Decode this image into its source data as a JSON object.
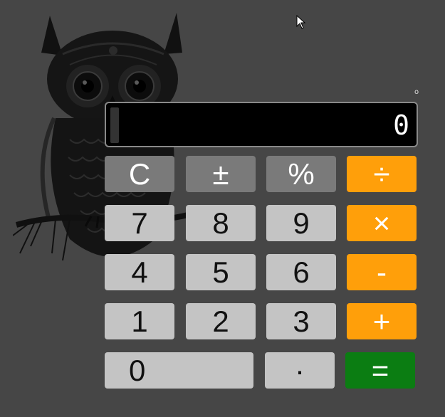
{
  "display": {
    "value": "0"
  },
  "decor": {
    "corner_mark": "o"
  },
  "keys": {
    "clear": "C",
    "sign": "±",
    "percent": "%",
    "divide": "÷",
    "seven": "7",
    "eight": "8",
    "nine": "9",
    "multiply": "×",
    "four": "4",
    "five": "5",
    "six": "6",
    "minus": "-",
    "one": "1",
    "two": "2",
    "three": "3",
    "plus": "+",
    "zero": "0",
    "decimal": "·",
    "equals": "="
  },
  "colors": {
    "background": "#464646",
    "function_key": "#7a7a7a",
    "digit_key": "#c4c4c4",
    "operator_key": "#ff9f0a",
    "equals_key": "#0b7d12",
    "display_bg": "#000000"
  },
  "icons": {
    "cursor": "mouse-pointer-icon",
    "background_art": "owl-illustration"
  }
}
